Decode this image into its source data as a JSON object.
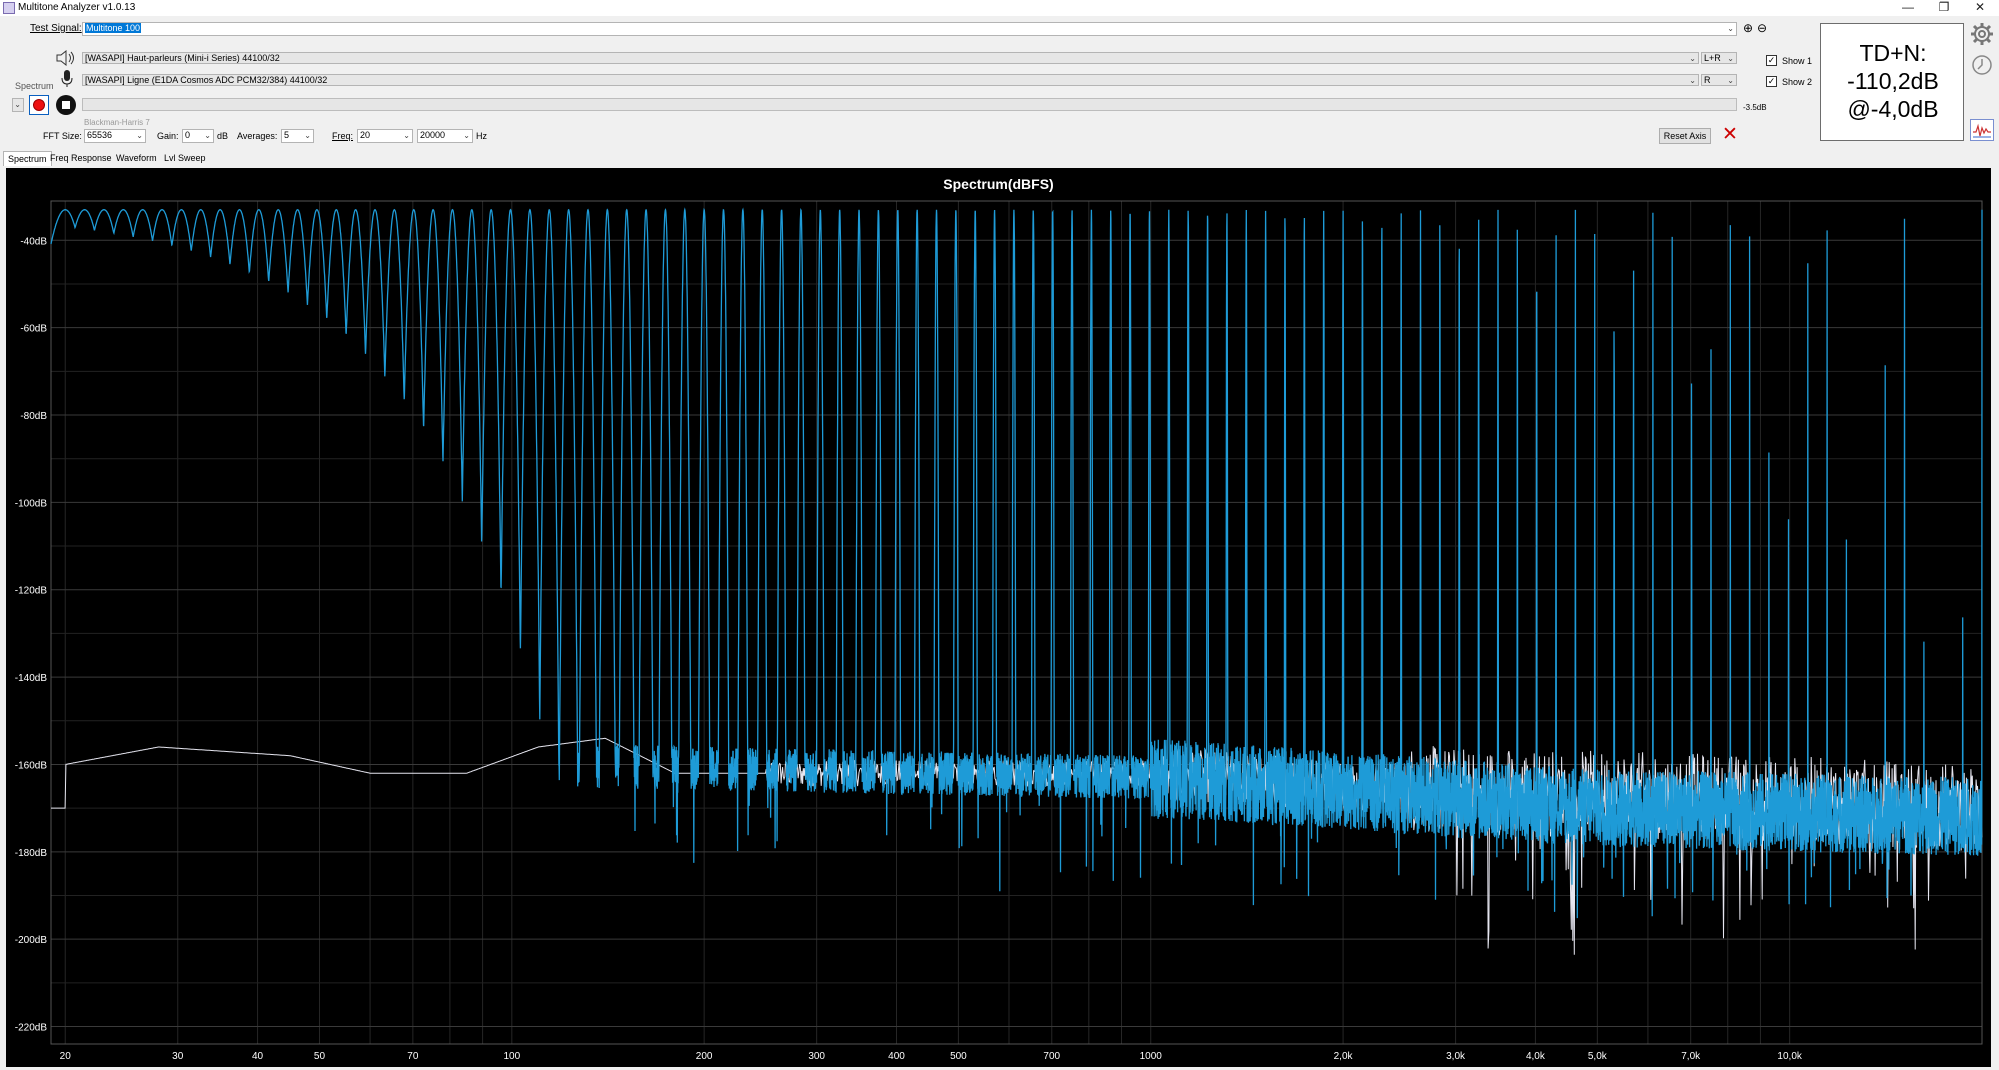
{
  "window": {
    "title": "Multitone Analyzer v1.0.13",
    "minimize": "—",
    "restore": "❐",
    "close": "✕"
  },
  "controls": {
    "test_signal_label": "Test Signal:",
    "test_signal_value": "Multitone 100",
    "output_device": "[WASAPI] Haut-parleurs (Mini-i Series) 44100/32",
    "output_channel": "L+R",
    "input_device": "[WASAPI] Ligne (E1DA Cosmos ADC PCM32/384) 44100/32",
    "input_channel": "R",
    "mode_label": "Spectrum",
    "level_readout": "-3.5dB",
    "window_function": "Blackman-Harris 7",
    "fft_size_label": "FFT Size:",
    "fft_size": "65536",
    "gain_label": "Gain:",
    "gain": "0",
    "gain_unit": "dB",
    "averages_label": "Averages:",
    "averages": "5",
    "freq_label": "Freq:",
    "freq_min": "20",
    "freq_max": "20000",
    "freq_unit": "Hz",
    "reset_axis": "Reset Axis",
    "show1": "Show 1",
    "show2": "Show 2"
  },
  "thd": {
    "line1": "TD+N:",
    "line2": "-110,2dB",
    "line3": "@-4,0dB"
  },
  "tabs": [
    "Spectrum",
    "Freq Response",
    "Waveform",
    "Lvl Sweep"
  ],
  "chart_data": {
    "type": "line",
    "title": "Spectrum(dBFS)",
    "x_scale": "log",
    "xlim": [
      19,
      20000
    ],
    "ylim": [
      -224,
      -31
    ],
    "x_ticks": [
      20,
      30,
      40,
      50,
      70,
      100,
      200,
      300,
      400,
      500,
      700,
      1000,
      2000,
      3000,
      4000,
      5000,
      7000,
      10000
    ],
    "x_tick_labels": [
      "20",
      "30",
      "40",
      "50",
      "70",
      "100",
      "200",
      "300",
      "400",
      "500",
      "700",
      "1000",
      "2,0k",
      "3,0k",
      "4,0k",
      "5,0k",
      "7,0k",
      "10,0k"
    ],
    "y_ticks": [
      -40,
      -60,
      -80,
      -100,
      -120,
      -140,
      -160,
      -180,
      -200,
      -220
    ],
    "y_tick_labels": [
      "-40dB",
      "-60dB",
      "-80dB",
      "-100dB",
      "-120dB",
      "-140dB",
      "-160dB",
      "-180dB",
      "-200dB",
      "-220dB"
    ],
    "grid": true,
    "series": [
      {
        "color": "#1e9bd7",
        "tones": {
          "count": 100,
          "f_start": 20,
          "f_end": 20000,
          "peak_level_db": -33
        },
        "noise_floor_db": [
          [
            20,
            -160
          ],
          [
            100,
            -160
          ],
          [
            1000,
            -163
          ],
          [
            5000,
            -170
          ],
          [
            20000,
            -172
          ]
        ]
      },
      {
        "color": "#e6e6f0",
        "noise_floor_db": [
          [
            20,
            -160
          ],
          [
            28,
            -156
          ],
          [
            45,
            -158
          ],
          [
            60,
            -162
          ],
          [
            85,
            -162
          ],
          [
            110,
            -156
          ],
          [
            140,
            -154
          ],
          [
            180,
            -162
          ],
          [
            300,
            -162
          ],
          [
            1000,
            -162
          ],
          [
            3000,
            -166
          ],
          [
            10000,
            -168
          ],
          [
            20000,
            -170
          ]
        ]
      }
    ]
  }
}
